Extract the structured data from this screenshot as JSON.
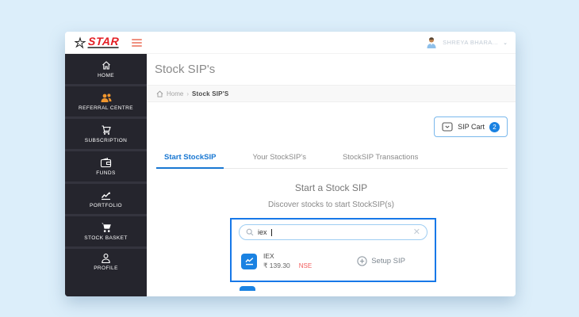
{
  "brand": {
    "name": "STAR"
  },
  "topbar": {
    "user_name": "SHREYA BHARA...",
    "chevron": "⌄"
  },
  "sidebar": {
    "items": [
      {
        "label": "HOME",
        "icon": "home-icon"
      },
      {
        "label": "REFERRAL CENTRE",
        "icon": "people-icon"
      },
      {
        "label": "SUBSCRIPTION",
        "icon": "cart-outline-icon"
      },
      {
        "label": "FUNDS",
        "icon": "wallet-icon"
      },
      {
        "label": "PORTFOLIO",
        "icon": "chart-icon"
      },
      {
        "label": "STOCK BASKET",
        "icon": "cart-filled-icon"
      },
      {
        "label": "PROFILE",
        "icon": "person-icon"
      }
    ]
  },
  "page": {
    "title": "Stock SIP's",
    "breadcrumb": {
      "home": "Home",
      "separator": "›",
      "current": "Stock SIP'S"
    },
    "sip_cart": {
      "label": "SIP Cart",
      "count": "2"
    }
  },
  "tabs": [
    {
      "label": "Start StockSIP",
      "active": true
    },
    {
      "label": "Your StockSIP's",
      "active": false
    },
    {
      "label": "StockSIP Transactions",
      "active": false
    }
  ],
  "start_sip": {
    "heading": "Start a Stock SIP",
    "subheading": "Discover stocks to start StockSIP(s)",
    "search": {
      "value": "iex"
    },
    "result": {
      "symbol": "IEX",
      "price": "₹ 139.30",
      "exchange": "NSE",
      "action_label": "Setup SIP"
    }
  },
  "colors": {
    "accent_blue": "#1a82e2",
    "tab_blue": "#1877d2",
    "highlight_border": "#1778e8",
    "brand_red": "#e31e24",
    "exchange_red": "#f25c5c",
    "sidebar_bg": "#25252d",
    "page_bg": "#dceefa"
  }
}
